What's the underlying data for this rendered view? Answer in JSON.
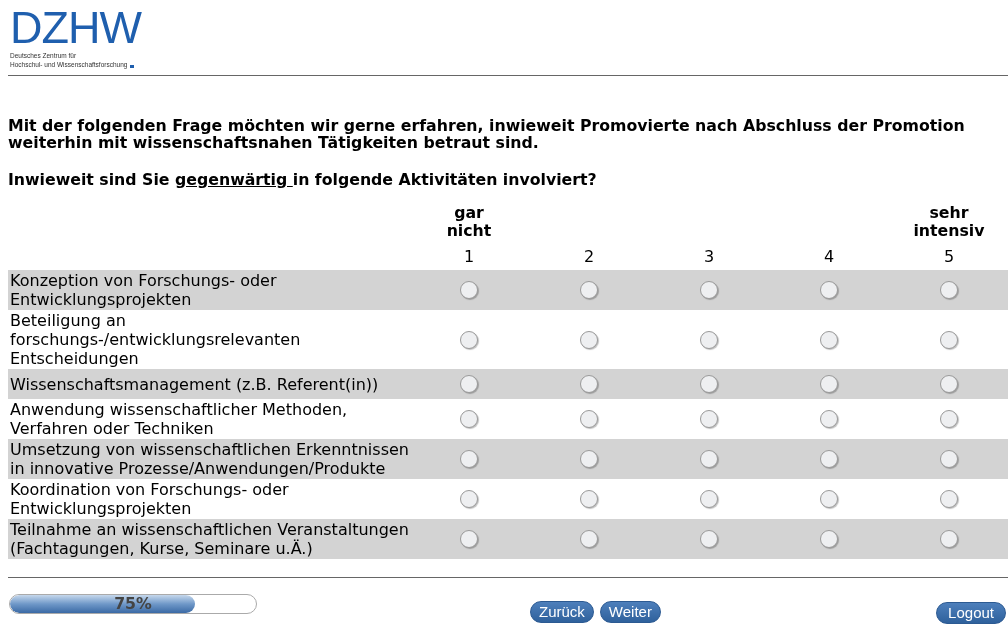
{
  "logo": {
    "wordmark": "DZHW",
    "subtitle_lines": [
      "Deutsches Zentrum für",
      "Hochschul- und Wissenschaftsforschung"
    ]
  },
  "intro": "Mit der folgenden Frage möchten wir gerne erfahren, inwieweit Promovierte nach Abschluss der Promotion weiterhin mit wissenschaftsnahen Tätigkeiten betraut sind.",
  "question": {
    "before": "Inwieweit sind Sie ",
    "underlined": "gegenwärtig ",
    "after": "in folgende Aktivitäten involviert?"
  },
  "scale": [
    {
      "label": "gar nicht",
      "value": "1"
    },
    {
      "value": "2"
    },
    {
      "value": "3"
    },
    {
      "value": "4"
    },
    {
      "label": "sehr intensiv",
      "value": "5"
    }
  ],
  "items": [
    {
      "text": "Konzeption von Forschungs- oder Entwicklungsprojekten",
      "options": [
        {
          "selected": false
        },
        {
          "selected": false
        },
        {
          "selected": false
        },
        {
          "selected": false
        },
        {
          "selected": false
        }
      ]
    },
    {
      "text": "Beteiligung an forschungs-/entwicklungsrelevanten Entscheidungen",
      "options": [
        {
          "selected": false
        },
        {
          "selected": false
        },
        {
          "selected": false
        },
        {
          "selected": false
        },
        {
          "selected": false
        }
      ]
    },
    {
      "text": "Wissenschaftsmanagement (z.B. Referent(in))",
      "options": [
        {
          "selected": false
        },
        {
          "selected": false
        },
        {
          "selected": false
        },
        {
          "selected": false
        },
        {
          "selected": false
        }
      ]
    },
    {
      "text": "Anwendung wissenschaftlicher Methoden, Verfahren oder Techniken",
      "options": [
        {
          "selected": false
        },
        {
          "selected": false
        },
        {
          "selected": false
        },
        {
          "selected": false
        },
        {
          "selected": false
        }
      ]
    },
    {
      "text": "Umsetzung von wissenschaftlichen Erkenntnissen in innovative Prozesse/Anwendungen/Produkte",
      "options": [
        {
          "selected": false
        },
        {
          "selected": false
        },
        {
          "selected": false
        },
        {
          "selected": false
        },
        {
          "selected": false
        }
      ]
    },
    {
      "text": "Koordination von Forschungs- oder Entwicklungsprojekten",
      "options": [
        {
          "selected": false
        },
        {
          "selected": false
        },
        {
          "selected": false
        },
        {
          "selected": false
        },
        {
          "selected": false
        }
      ]
    },
    {
      "text": "Teilnahme an wissenschaftlichen Veranstaltungen (Fachtagungen, Kurse, Seminare u.Ä.)",
      "options": [
        {
          "selected": false
        },
        {
          "selected": false
        },
        {
          "selected": false
        },
        {
          "selected": false
        },
        {
          "selected": false
        }
      ]
    }
  ],
  "progress": {
    "level": 0.75,
    "label": "75%"
  },
  "nav_buttons": [
    {
      "label": "Zurück"
    },
    {
      "label": "Weiter"
    }
  ],
  "logout": {
    "label": "Logout"
  }
}
